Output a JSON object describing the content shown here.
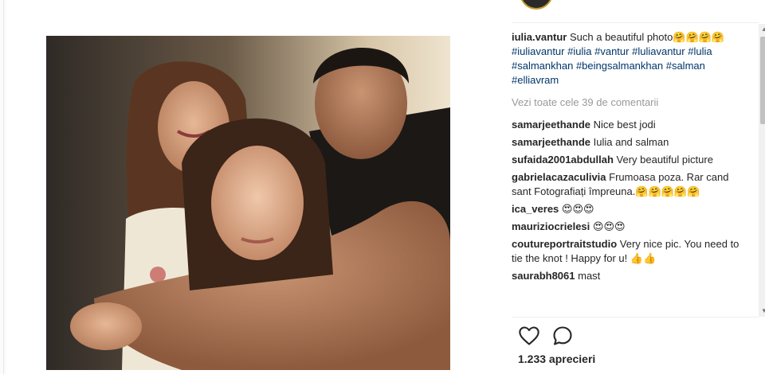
{
  "post": {
    "caption": {
      "username": "iulia.vantur",
      "text": "Such a beautiful photo🤗🤗🤗🤗",
      "hashtags": [
        "#iuliavantur",
        "#iulia",
        "#vantur",
        "#luliavantur",
        "#lulia",
        "#salmankhan",
        "#beingsalmankhan",
        "#salman",
        "#elliavram"
      ]
    },
    "view_all_comments": "Vezi toate cele 39 de comentarii",
    "comments": [
      {
        "username": "samarjeethande",
        "text": "Nice best jodi"
      },
      {
        "username": "samarjeethande",
        "text": "Iulia and salman"
      },
      {
        "username": "sufaida2001abdullah",
        "text": "Very beautiful picture"
      },
      {
        "username": "gabrielacazaculivia",
        "text": "Frumoasa poza. Rar cand sant Fotografiați împreuna.🤗🤗🤗🤗🤗"
      },
      {
        "username": "ica_veres",
        "text": "😍😍😍"
      },
      {
        "username": "mauriziocrielesi",
        "text": "😍😍😍"
      },
      {
        "username": "coutureportraitstudio",
        "text": "Very nice pic. You need to tie the knot ! Happy for u! 👍👍"
      },
      {
        "username": "saurabh8061",
        "text": "mast"
      }
    ],
    "likes": "1.233 aprecieri"
  },
  "icons": {
    "like": "heart-icon",
    "comment": "comment-bubble-icon",
    "scroll_up": "scroll-up-arrow-icon",
    "scroll_down": "scroll-down-arrow-icon"
  },
  "colors": {
    "hashtag": "#003569",
    "muted": "#999999",
    "text": "#262626"
  }
}
